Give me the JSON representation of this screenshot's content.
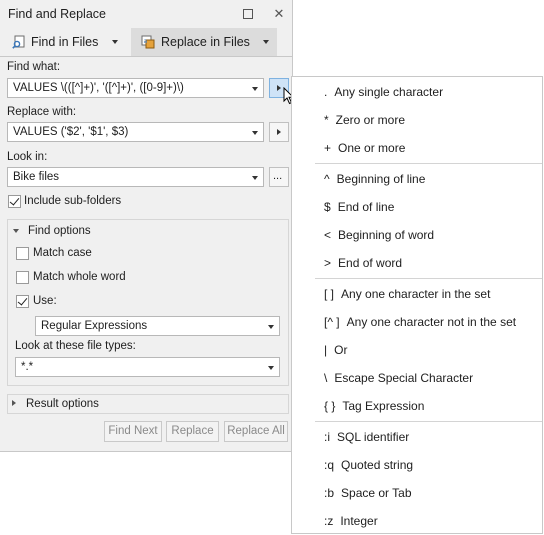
{
  "window": {
    "title": "Find and Replace"
  },
  "tabs": [
    {
      "label": "Find in Files"
    },
    {
      "label": "Replace in Files"
    }
  ],
  "find_what": {
    "label": "Find what:",
    "value": "VALUES \\(([^]+)', '([^]+)', ([0-9]+)\\)"
  },
  "replace_with": {
    "label": "Replace with:",
    "value": "VALUES ('$2', '$1', $3)"
  },
  "look_in": {
    "label": "Look in:",
    "value": "Bike files",
    "browse": "..."
  },
  "include_subfolders": {
    "label": "Include sub-folders",
    "checked": true
  },
  "find_options": {
    "header": "Find options",
    "match_case": {
      "label": "Match case",
      "checked": false
    },
    "match_whole_word": {
      "label": "Match whole word",
      "checked": false
    },
    "use": {
      "label": "Use:",
      "checked": true
    },
    "use_mode": "Regular Expressions",
    "file_types_label": "Look at these file types:",
    "file_types": "*.*"
  },
  "result_options": {
    "header": "Result options"
  },
  "buttons": {
    "find_next": "Find Next",
    "replace": "Replace",
    "replace_all": "Replace All"
  },
  "menu": {
    "groups": [
      [
        {
          "symbol": ".",
          "text": "Any single character"
        },
        {
          "symbol": "*",
          "text": "Zero or more"
        },
        {
          "symbol": "+",
          "text": "One or more"
        }
      ],
      [
        {
          "symbol": "^",
          "text": "Beginning of line"
        },
        {
          "symbol": "$",
          "text": "End of line"
        },
        {
          "symbol": "<",
          "text": "Beginning of word"
        },
        {
          "symbol": ">",
          "text": "End of word"
        }
      ],
      [
        {
          "symbol": "[ ]",
          "text": "Any one character in the set"
        },
        {
          "symbol": "[^ ]",
          "text": "Any one character not in the set"
        },
        {
          "symbol": "|",
          "text": "Or"
        },
        {
          "symbol": "\\",
          "text": "Escape Special Character"
        },
        {
          "symbol": "{ }",
          "text": "Tag Expression"
        }
      ],
      [
        {
          "symbol": ":i",
          "text": "SQL identifier"
        },
        {
          "symbol": ":q",
          "text": "Quoted string"
        },
        {
          "symbol": ":b",
          "text": "Space or Tab"
        },
        {
          "symbol": ":z",
          "text": "Integer"
        }
      ]
    ]
  },
  "colors": {
    "panel_bg": "#f0f0f0",
    "active_tab": "#dcdcdc",
    "active_button": "#cfe3f7"
  }
}
